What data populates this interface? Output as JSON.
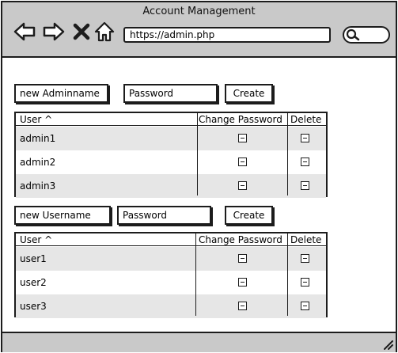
{
  "window": {
    "title": "Account Management",
    "url": "https://admin.php",
    "search_placeholder": ""
  },
  "admin_section": {
    "name_input_placeholder": "new Adminname",
    "password_input_placeholder": "Password",
    "create_label": "Create",
    "columns": [
      "User ^",
      "Change Password",
      "Delete"
    ],
    "rows": [
      {
        "user": "admin1"
      },
      {
        "user": "admin2"
      },
      {
        "user": "admin3"
      }
    ]
  },
  "user_section": {
    "name_input_placeholder": "new Username",
    "password_input_placeholder": "Password",
    "create_label": "Create",
    "columns": [
      "User ^",
      "Change Password",
      "Delete"
    ],
    "rows": [
      {
        "user": "user1"
      },
      {
        "user": "user2"
      },
      {
        "user": "user3"
      }
    ]
  },
  "icons": {
    "back": "arrow-left-icon",
    "forward": "arrow-right-icon",
    "stop": "close-icon",
    "home": "home-icon",
    "search": "search-icon",
    "checkbox": "minus-checkbox-icon",
    "resize": "resize-grip-icon"
  },
  "colors": {
    "chrome": "#c9c9c9",
    "row_shade": "#e6e6e6",
    "stroke": "#1c1c1c"
  }
}
